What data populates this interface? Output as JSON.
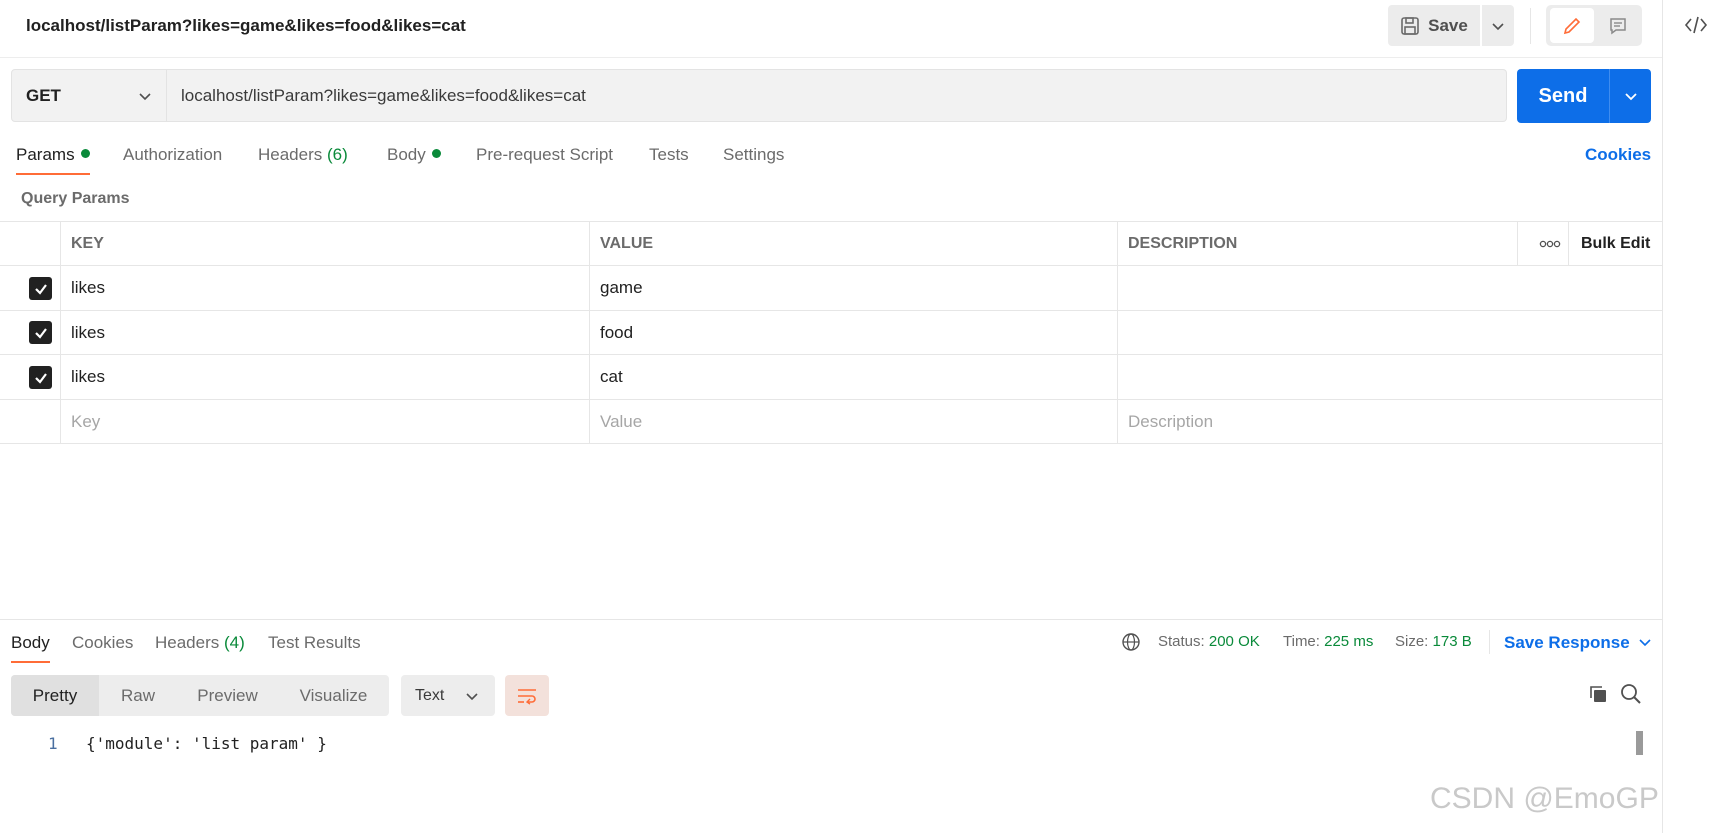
{
  "request": {
    "title": "localhost/listParam?likes=game&likes=food&likes=cat",
    "method": "GET",
    "url": "localhost/listParam?likes=game&likes=food&likes=cat",
    "save_label": "Save",
    "send_label": "Send"
  },
  "tabs": {
    "params": "Params",
    "authorization": "Authorization",
    "headers": "Headers",
    "headers_count": "(6)",
    "body": "Body",
    "prerequest": "Pre-request Script",
    "tests": "Tests",
    "settings": "Settings",
    "cookies": "Cookies"
  },
  "query_params": {
    "title": "Query Params",
    "columns": {
      "key": "KEY",
      "value": "VALUE",
      "description": "DESCRIPTION",
      "bulk_edit": "Bulk Edit"
    },
    "rows": [
      {
        "key": "likes",
        "value": "game",
        "description": ""
      },
      {
        "key": "likes",
        "value": "food",
        "description": ""
      },
      {
        "key": "likes",
        "value": "cat",
        "description": ""
      }
    ],
    "placeholders": {
      "key": "Key",
      "value": "Value",
      "description": "Description"
    }
  },
  "response": {
    "tabs": {
      "body": "Body",
      "cookies": "Cookies",
      "headers": "Headers",
      "headers_count": "(4)",
      "test_results": "Test Results"
    },
    "status_label": "Status:",
    "status_value": "200 OK",
    "time_label": "Time:",
    "time_value": "225 ms",
    "size_label": "Size:",
    "size_value": "173 B",
    "save_response": "Save Response",
    "views": {
      "pretty": "Pretty",
      "raw": "Raw",
      "preview": "Preview",
      "visualize": "Visualize"
    },
    "format": "Text",
    "line_number": "1",
    "body_text": "{'module': 'list param' }"
  },
  "watermark": "CSDN @EmoGP",
  "colors": {
    "accent": "#ff6c37",
    "primary": "#0d6ee8",
    "success": "#0a8a3a"
  }
}
